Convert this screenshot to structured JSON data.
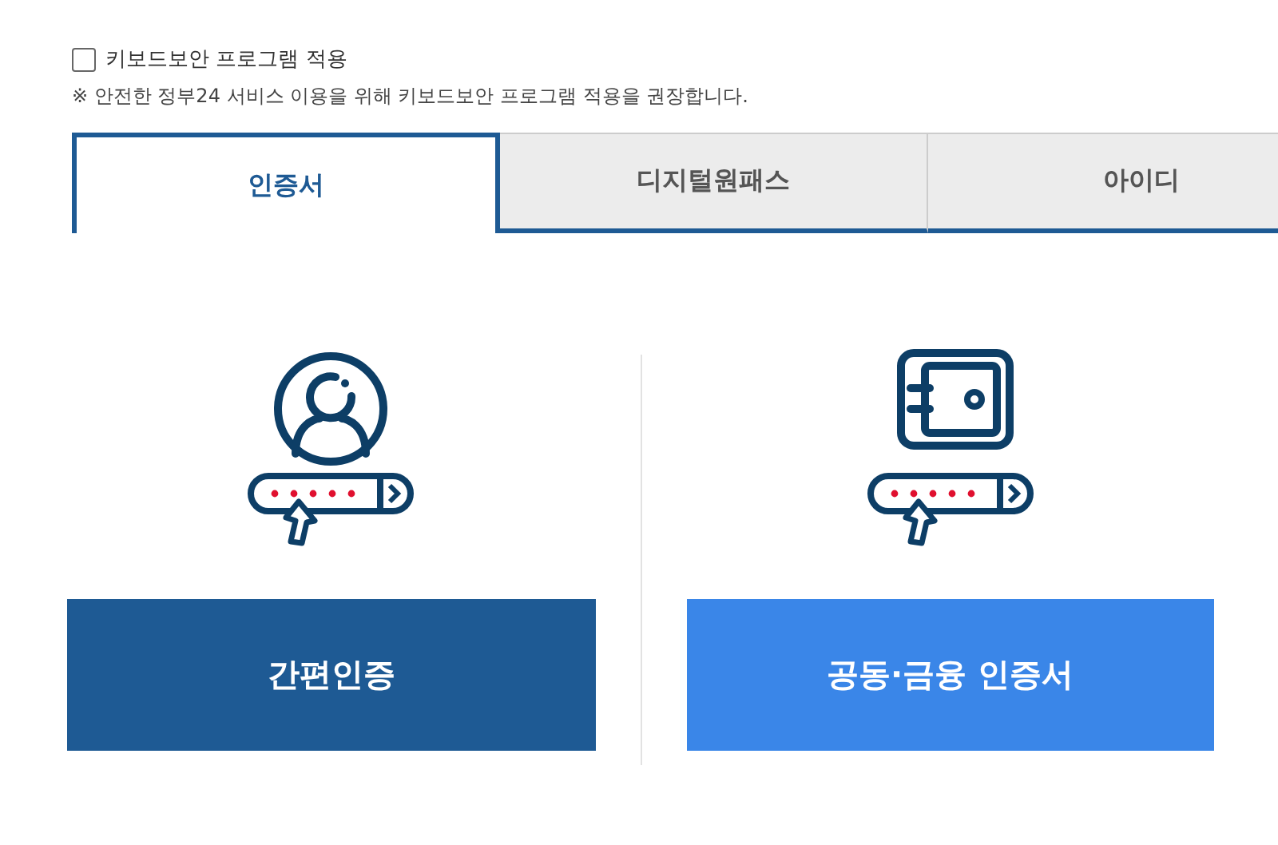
{
  "keyboard_security": {
    "label": "키보드보안 프로그램 적용",
    "checked": false,
    "note": "※ 안전한 정부24 서비스 이용을 위해 키보드보안 프로그램 적용을 권장합니다."
  },
  "tabs": [
    {
      "label": "인증서",
      "selected": true
    },
    {
      "label": "디지털원패스",
      "selected": false
    },
    {
      "label": "아이디",
      "selected": false
    }
  ],
  "options": [
    {
      "kind": "person",
      "button": "간편인증"
    },
    {
      "kind": "safe",
      "button": "공동·금융 인증서"
    }
  ]
}
